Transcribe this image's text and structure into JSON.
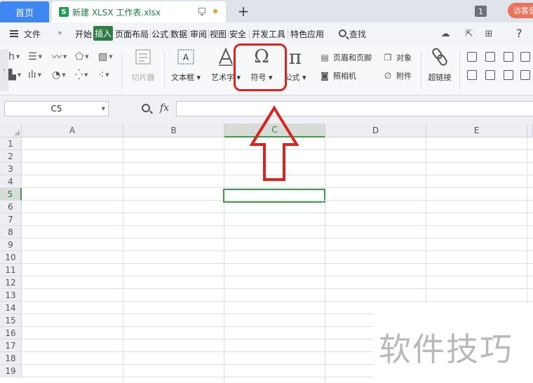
{
  "tabs": {
    "home_label": "首页",
    "doc_icon_letter": "S",
    "doc_label": "新建 XLSX 工作表.xlsx",
    "window_count": "1",
    "visitor_label": "访客登录"
  },
  "menu": {
    "file_label": "文件",
    "more_label": "»",
    "items": [
      "开始",
      "插入",
      "页面布局",
      "公式",
      "数据",
      "审阅",
      "视图",
      "安全",
      "开发工具",
      "特色应用"
    ],
    "active_item": "插入",
    "search_label": "查找",
    "help_label": "?"
  },
  "ribbon": {
    "slicer_label": "切片器",
    "textbox_label": "文本框",
    "wordart_label": "艺术字",
    "symbol_label": "符号",
    "formula_label": "公式",
    "header_footer_label": "页眉和页脚",
    "camera_label": "照相机",
    "object_label": "对象",
    "attachment_label": "附件",
    "hyperlink_label": "超链接",
    "symbol_glyph": "Ω",
    "formula_glyph": "π"
  },
  "formula_bar": {
    "name_box_value": "C5",
    "fx_label": "fx",
    "formula_value": ""
  },
  "sheet": {
    "columns": [
      "A",
      "B",
      "C",
      "D",
      "E"
    ],
    "rows": [
      "1",
      "2",
      "3",
      "4",
      "5",
      "6",
      "7",
      "8",
      "9",
      "10",
      "11",
      "12",
      "13",
      "14",
      "15",
      "16",
      "17",
      "18",
      "19"
    ],
    "active_column": "C",
    "active_row": "5"
  },
  "watermark": {
    "text": "软件技巧"
  },
  "colors": {
    "accent_green": "#2f7d46",
    "home_tab_blue": "#3f86f2",
    "highlight_red": "#d9251d",
    "visitor_orange": "#e9735d"
  }
}
